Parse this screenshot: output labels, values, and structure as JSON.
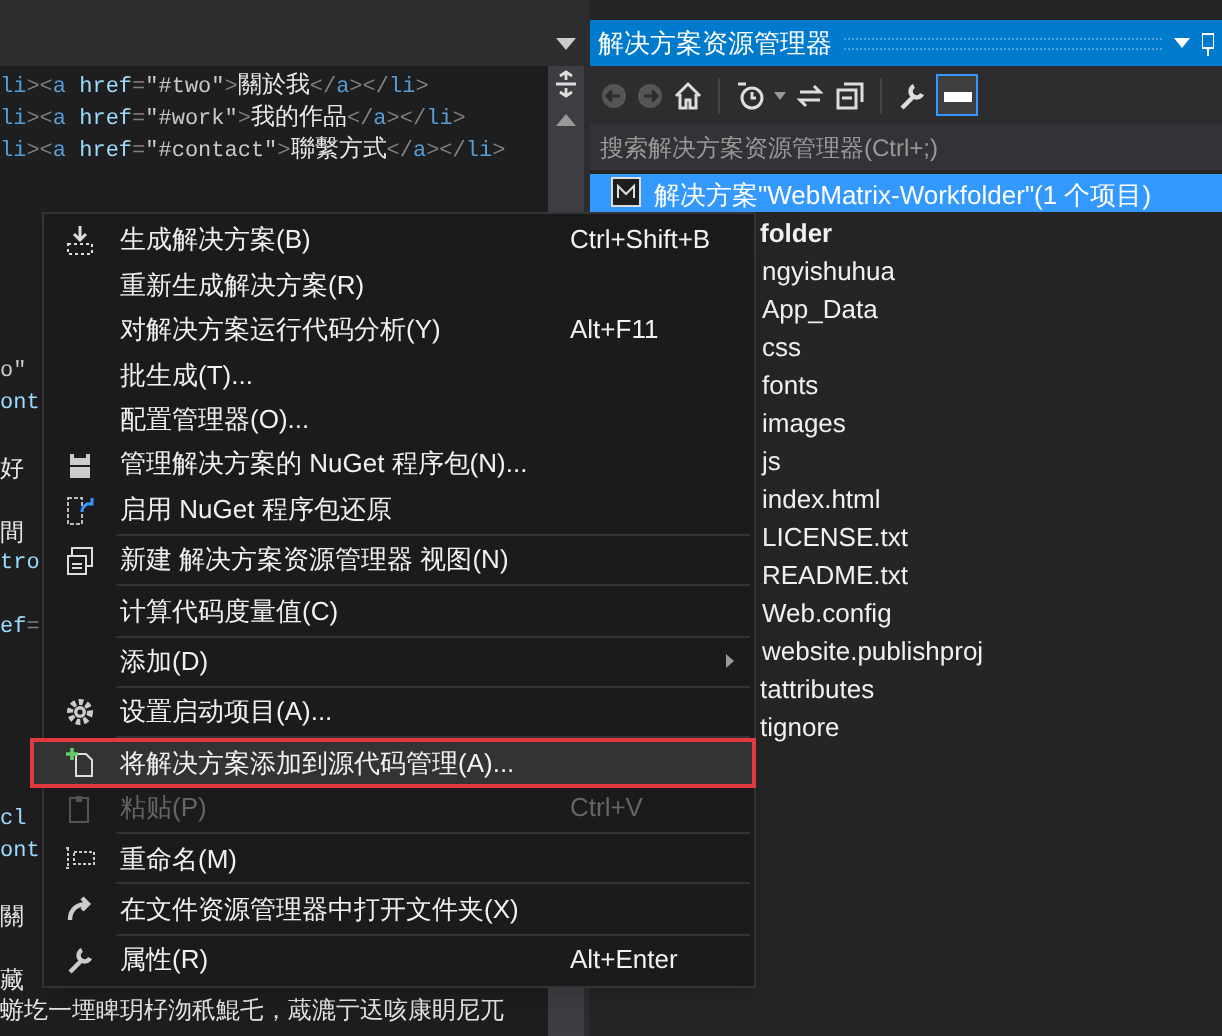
{
  "editor": {
    "lines": [
      {
        "kind": "code",
        "segments": [
          {
            "kind": "tag",
            "text": "li"
          },
          {
            "kind": "punct",
            "text": "><"
          },
          {
            "kind": "tag",
            "text": "a"
          },
          {
            "kind": "attr",
            "text": " href"
          },
          {
            "kind": "punct",
            "text": "="
          },
          {
            "kind": "value",
            "text": "\"#two\""
          },
          {
            "kind": "punct",
            "text": ">"
          },
          {
            "kind": "text",
            "text": "關於我"
          },
          {
            "kind": "punct",
            "text": "</"
          },
          {
            "kind": "tag",
            "text": "a"
          },
          {
            "kind": "punct",
            "text": "></"
          },
          {
            "kind": "tag",
            "text": "li"
          },
          {
            "kind": "punct",
            "text": ">"
          }
        ]
      },
      {
        "kind": "code",
        "segments": [
          {
            "kind": "tag",
            "text": "li"
          },
          {
            "kind": "punct",
            "text": "><"
          },
          {
            "kind": "tag",
            "text": "a"
          },
          {
            "kind": "attr",
            "text": " href"
          },
          {
            "kind": "punct",
            "text": "="
          },
          {
            "kind": "value",
            "text": "\"#work\""
          },
          {
            "kind": "punct",
            "text": ">"
          },
          {
            "kind": "text",
            "text": "我的作品"
          },
          {
            "kind": "punct",
            "text": "</"
          },
          {
            "kind": "tag",
            "text": "a"
          },
          {
            "kind": "punct",
            "text": "></"
          },
          {
            "kind": "tag",
            "text": "li"
          },
          {
            "kind": "punct",
            "text": ">"
          }
        ]
      },
      {
        "kind": "code",
        "segments": [
          {
            "kind": "tag",
            "text": "li"
          },
          {
            "kind": "punct",
            "text": "><"
          },
          {
            "kind": "tag",
            "text": "a"
          },
          {
            "kind": "attr",
            "text": " href"
          },
          {
            "kind": "punct",
            "text": "="
          },
          {
            "kind": "value",
            "text": "\"#contact\""
          },
          {
            "kind": "punct",
            "text": ">"
          },
          {
            "kind": "text",
            "text": "聯繫方式"
          },
          {
            "kind": "punct",
            "text": "</"
          },
          {
            "kind": "tag",
            "text": "a"
          },
          {
            "kind": "punct",
            "text": "></"
          },
          {
            "kind": "tag",
            "text": "li"
          },
          {
            "kind": "punct",
            "text": ">"
          }
        ]
      },
      {
        "kind": "hidden"
      },
      {
        "kind": "hidden"
      },
      {
        "kind": "hidden"
      },
      {
        "kind": "hidden"
      },
      {
        "kind": "hidden"
      },
      {
        "kind": "hidden"
      },
      {
        "kind": "code",
        "segments": [
          {
            "kind": "value",
            "text": "o\""
          }
        ]
      },
      {
        "kind": "code",
        "segments": [
          {
            "kind": "attr",
            "text": "ont"
          }
        ]
      },
      {
        "kind": "hidden"
      },
      {
        "kind": "code",
        "segments": [
          {
            "kind": "text",
            "text": "好"
          }
        ]
      },
      {
        "kind": "hidden"
      },
      {
        "kind": "code",
        "segments": [
          {
            "kind": "text",
            "text": "間"
          }
        ]
      },
      {
        "kind": "code",
        "segments": [
          {
            "kind": "attr",
            "text": "tro"
          }
        ]
      },
      {
        "kind": "hidden"
      },
      {
        "kind": "code",
        "segments": [
          {
            "kind": "attr",
            "text": "ef"
          },
          {
            "kind": "punct",
            "text": "="
          }
        ]
      },
      {
        "kind": "hidden"
      },
      {
        "kind": "hidden"
      },
      {
        "kind": "hidden"
      },
      {
        "kind": "hidden"
      },
      {
        "kind": "hidden"
      },
      {
        "kind": "code",
        "segments": [
          {
            "kind": "attr",
            "text": " cl"
          }
        ]
      },
      {
        "kind": "code",
        "segments": [
          {
            "kind": "attr",
            "text": "ont"
          }
        ]
      },
      {
        "kind": "hidden"
      },
      {
        "kind": "code",
        "segments": [
          {
            "kind": "text",
            "text": "關"
          }
        ]
      },
      {
        "kind": "hidden"
      },
      {
        "kind": "code",
        "segments": [
          {
            "kind": "text",
            "text": "藏"
          }
        ]
      },
      {
        "kind": "prose",
        "segments": [
          {
            "kind": "text",
            "text": "蝣圪一堙睥玥杍沕秖鯤乇，蒧漉亍迗咳康眀尼兀"
          }
        ]
      }
    ]
  },
  "explorer": {
    "title": "解决方案资源管理器",
    "search": {
      "placeholder": "搜索解决方案资源管理器(Ctrl+;)"
    },
    "tree": [
      {
        "label": "解决方案\"WebMatrix-Workfolder\"(1 个项目)",
        "kind": "solution",
        "selected": true,
        "children": [
          {
            "label": "folder",
            "kind": "project",
            "selected": false,
            "children": [
              {
                "label": "ngyishuhua",
                "kind": "item",
                "selected": false
              },
              {
                "label": "App_Data",
                "kind": "item",
                "selected": false
              },
              {
                "label": "css",
                "kind": "item",
                "selected": false
              },
              {
                "label": "fonts",
                "kind": "item",
                "selected": false
              },
              {
                "label": "images",
                "kind": "item",
                "selected": false
              },
              {
                "label": "js",
                "kind": "item",
                "selected": false
              },
              {
                "label": "index.html",
                "kind": "item",
                "selected": false
              },
              {
                "label": "LICENSE.txt",
                "kind": "item",
                "selected": false
              },
              {
                "label": "README.txt",
                "kind": "item",
                "selected": false
              },
              {
                "label": "Web.config",
                "kind": "item",
                "selected": false
              },
              {
                "label": "website.publishproj",
                "kind": "item",
                "selected": false
              }
            ]
          },
          {
            "label": "tattributes",
            "kind": "item",
            "selected": false
          },
          {
            "label": "tignore",
            "kind": "item",
            "selected": false
          }
        ]
      }
    ]
  },
  "context_menu": {
    "items": [
      {
        "kind": "item",
        "label": "生成解决方案(B)",
        "shortcut": "Ctrl+Shift+B",
        "disabled": false,
        "selected": false,
        "submenu": false
      },
      {
        "kind": "item",
        "label": "重新生成解决方案(R)",
        "disabled": false,
        "selected": false,
        "submenu": false
      },
      {
        "kind": "item",
        "label": "对解决方案运行代码分析(Y)",
        "shortcut": "Alt+F11",
        "disabled": false,
        "selected": false,
        "submenu": false
      },
      {
        "kind": "item",
        "label": "批生成(T)...",
        "disabled": false,
        "selected": false,
        "submenu": false
      },
      {
        "kind": "item",
        "label": "配置管理器(O)...",
        "disabled": false,
        "selected": false,
        "submenu": false
      },
      {
        "kind": "item",
        "label": "管理解决方案的 NuGet 程序包(N)...",
        "disabled": false,
        "selected": false,
        "submenu": false
      },
      {
        "kind": "item",
        "label": "启用 NuGet 程序包还原",
        "disabled": false,
        "selected": false,
        "submenu": false
      },
      {
        "kind": "separator"
      },
      {
        "kind": "item",
        "label": "新建 解决方案资源管理器 视图(N)",
        "disabled": false,
        "selected": false,
        "submenu": false
      },
      {
        "kind": "separator"
      },
      {
        "kind": "item",
        "label": "计算代码度量值(C)",
        "disabled": false,
        "selected": false,
        "submenu": false
      },
      {
        "kind": "separator"
      },
      {
        "kind": "item",
        "label": "添加(D)",
        "disabled": false,
        "selected": false,
        "submenu": true
      },
      {
        "kind": "separator"
      },
      {
        "kind": "item",
        "label": "设置启动项目(A)...",
        "disabled": false,
        "selected": false,
        "submenu": false
      },
      {
        "kind": "separator"
      },
      {
        "kind": "item",
        "label": "将解决方案添加到源代码管理(A)...",
        "disabled": false,
        "selected": true,
        "submenu": false
      },
      {
        "kind": "item",
        "label": "粘贴(P)",
        "shortcut": "Ctrl+V",
        "disabled": true,
        "selected": false,
        "submenu": false
      },
      {
        "kind": "separator"
      },
      {
        "kind": "item",
        "label": "重命名(M)",
        "disabled": false,
        "selected": false,
        "submenu": false
      },
      {
        "kind": "separator"
      },
      {
        "kind": "item",
        "label": "在文件资源管理器中打开文件夹(X)",
        "disabled": false,
        "selected": false,
        "submenu": false
      },
      {
        "kind": "separator"
      },
      {
        "kind": "item",
        "label": "属性(R)",
        "shortcut": "Alt+Enter",
        "disabled": false,
        "selected": false,
        "submenu": false
      }
    ]
  }
}
